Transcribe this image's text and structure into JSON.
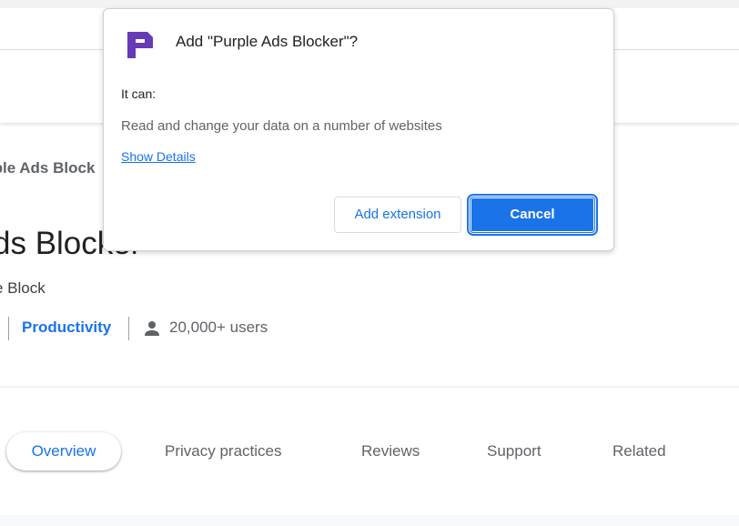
{
  "page": {
    "breadcrumb": "rple Ads Block",
    "title": "ds Blocker",
    "subtitle": "e Block",
    "category": "Productivity",
    "users": "20,000+ users",
    "users_icon": "person-icon"
  },
  "tabs": [
    {
      "label": "Overview",
      "active": true
    },
    {
      "label": "Privacy practices",
      "active": false
    },
    {
      "label": "Reviews",
      "active": false
    },
    {
      "label": "Support",
      "active": false
    },
    {
      "label": "Related",
      "active": false
    }
  ],
  "dialog": {
    "icon": "purple-p-logo-icon",
    "title": "Add \"Purple Ads Blocker\"?",
    "it_can": "It can:",
    "permissions": [
      "Read and change your data on a number of websites"
    ],
    "details_link": "Show Details",
    "add_button": "Add extension",
    "cancel_button": "Cancel"
  },
  "colors": {
    "accent": "#1a73e8",
    "brand_purple": "#673ab7",
    "text_primary": "#202124",
    "text_secondary": "#5f6368"
  }
}
